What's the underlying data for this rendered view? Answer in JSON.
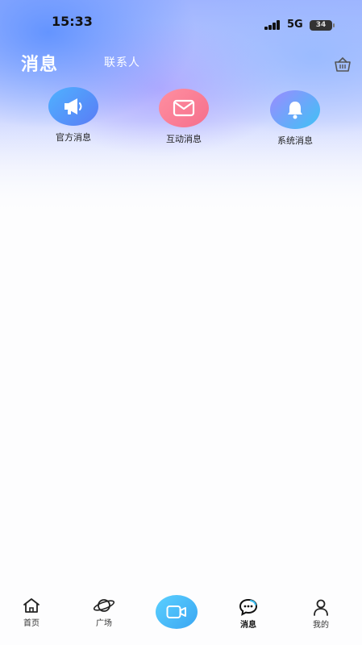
{
  "status_bar": {
    "time": "15:33",
    "network": "5G",
    "battery": "34"
  },
  "header": {
    "title": "消息",
    "contacts_tab": "联系人"
  },
  "entries": [
    {
      "label": "官方消息",
      "icon": "megaphone-icon"
    },
    {
      "label": "互动消息",
      "icon": "envelope-icon"
    },
    {
      "label": "系统消息",
      "icon": "bell-icon"
    }
  ],
  "bottom_nav": {
    "items": [
      {
        "label": "首页",
        "icon": "home-icon"
      },
      {
        "label": "广场",
        "icon": "planet-icon"
      },
      {
        "label": "",
        "icon": "video-camera-icon"
      },
      {
        "label": "消息",
        "icon": "chat-bubble-icon"
      },
      {
        "label": "我的",
        "icon": "user-icon"
      }
    ]
  },
  "colors": {
    "accent_blue": "#5a7cf5",
    "accent_pink": "#f56f8c",
    "accent_cyan": "#3ec2f5",
    "publish_button": "#3aa6f2"
  }
}
